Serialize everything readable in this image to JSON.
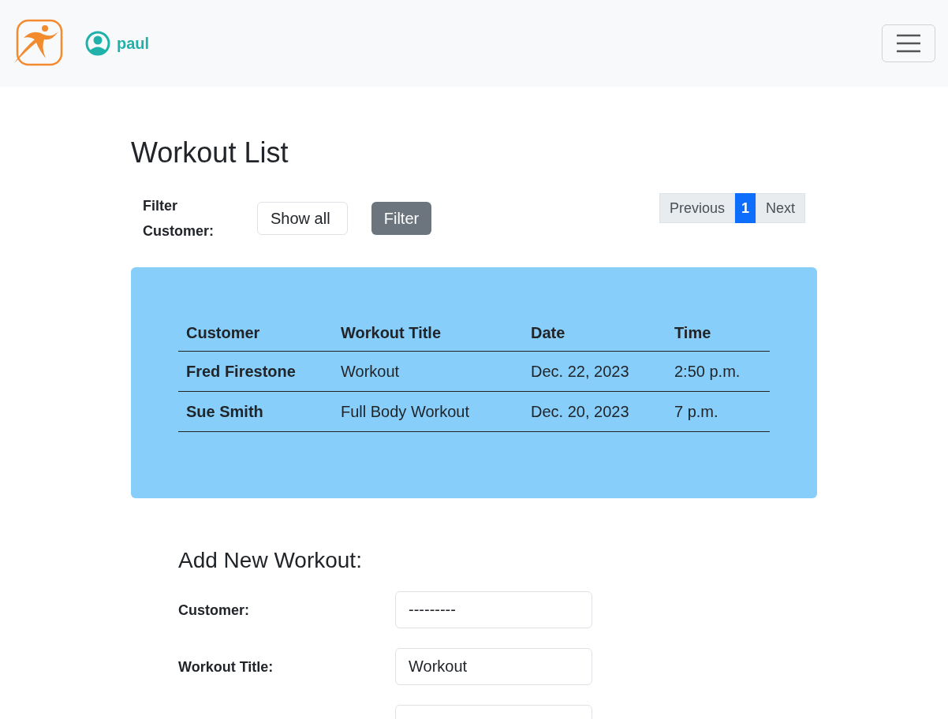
{
  "navbar": {
    "username": "paul"
  },
  "title": "Workout List",
  "filter": {
    "label": "Filter Customer:",
    "value": "Show all",
    "button": "Filter"
  },
  "pagination": [
    {
      "label": "Previous",
      "selected": false
    },
    {
      "label": "1",
      "selected": true
    },
    {
      "label": "Next",
      "selected": false
    }
  ],
  "table": {
    "columns": [
      "Customer",
      "Workout Title",
      "Date",
      "Time"
    ],
    "rows": [
      [
        "Fred Firestone",
        "Workout",
        "Dec. 22, 2023",
        "2:50 p.m."
      ],
      [
        "Sue Smith",
        "Full Body Workout",
        "Dec. 20, 2023",
        "7 p.m."
      ]
    ]
  },
  "form": {
    "heading": "Add New Workout:",
    "fields": [
      {
        "kind": "input",
        "label": "Customer:",
        "value": "---------"
      },
      {
        "kind": "input",
        "label": "Workout Title:",
        "value": "Workout"
      },
      {
        "kind": "input"
      }
    ]
  }
}
